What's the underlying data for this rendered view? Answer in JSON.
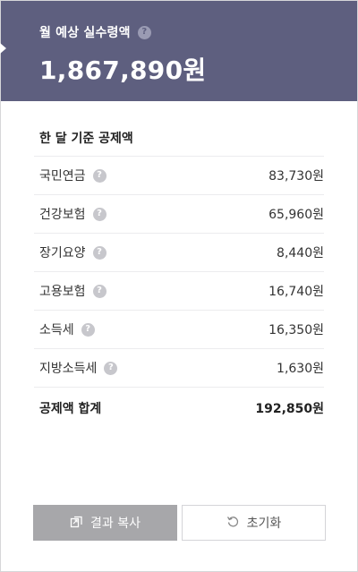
{
  "header": {
    "label": "월 예상 실수령액",
    "amount": "1,867,890원",
    "help_icon": "question-icon"
  },
  "deductions": {
    "title": "한 달 기준 공제액",
    "items": [
      {
        "label": "국민연금",
        "value": "83,730원"
      },
      {
        "label": "건강보험",
        "value": "65,960원"
      },
      {
        "label": "장기요양",
        "value": "8,440원"
      },
      {
        "label": "고용보험",
        "value": "16,740원"
      },
      {
        "label": "소득세",
        "value": "16,350원"
      },
      {
        "label": "지방소득세",
        "value": "1,630원"
      }
    ],
    "total_label": "공제액 합계",
    "total_value": "192,850원"
  },
  "buttons": {
    "copy_label": "결과 복사",
    "copy_icon": "copy-icon",
    "reset_label": "초기화",
    "reset_icon": "refresh-icon"
  },
  "colors": {
    "header_bg": "#5e5f7f",
    "copy_button_bg": "#a7a7aa"
  }
}
